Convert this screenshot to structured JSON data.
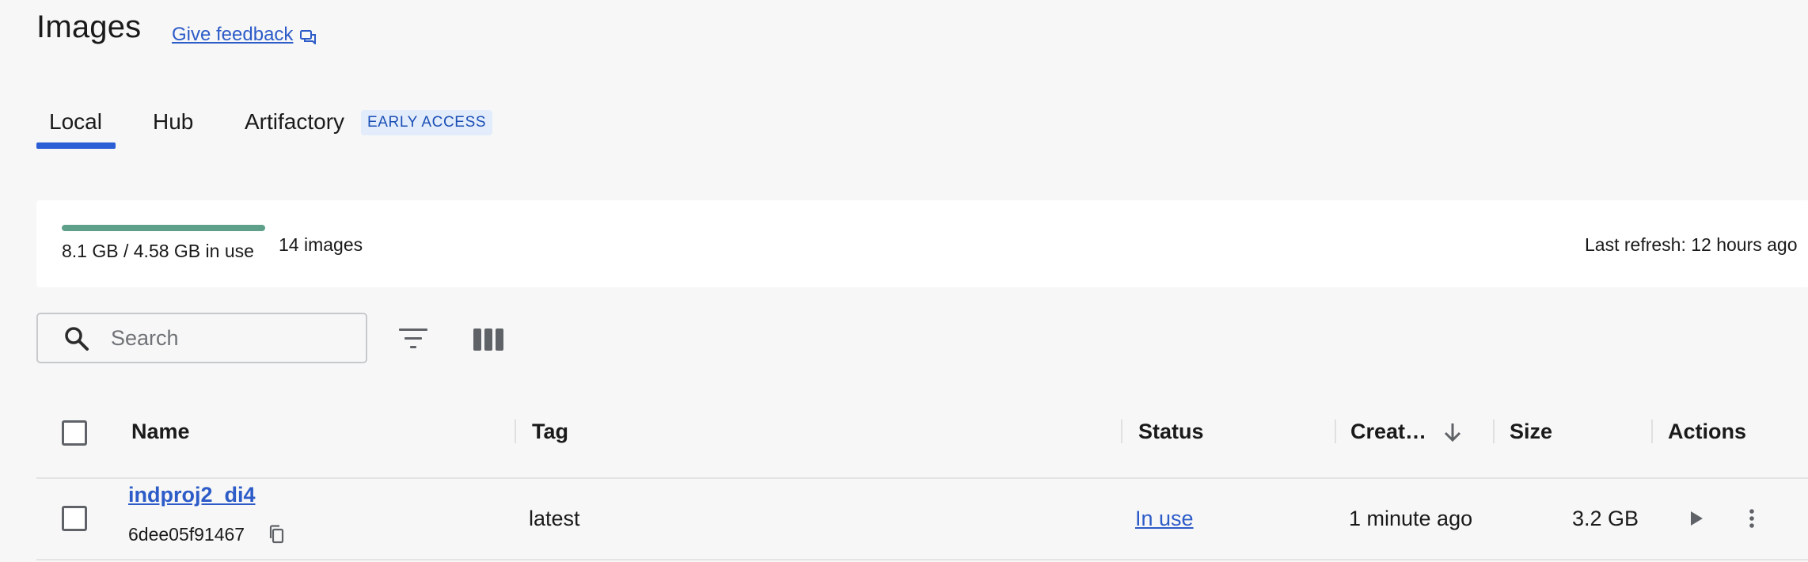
{
  "header": {
    "title": "Images",
    "feedback_label": "Give feedback"
  },
  "tabs": [
    {
      "label": "Local",
      "active": true
    },
    {
      "label": "Hub",
      "active": false
    },
    {
      "label": "Artifactory",
      "active": false,
      "badge": "EARLY ACCESS"
    }
  ],
  "usage": {
    "text": "8.1 GB / 4.58 GB in use",
    "count": "14 images",
    "last_refresh": "Last refresh: 12 hours ago",
    "bar_fill_fraction": 1.0,
    "bar_color": "#5ea08a"
  },
  "toolbar": {
    "search_placeholder": "Search",
    "search_icon": "search-icon",
    "filter_icon": "filter-icon",
    "columns_icon": "columns-icon"
  },
  "table": {
    "columns": [
      "Name",
      "Tag",
      "Status",
      "Creat…",
      "Size",
      "Actions"
    ],
    "sort_column": "Creat…",
    "sort_direction": "descending",
    "rows": [
      {
        "name": "indproj2_di4",
        "id": "6dee05f91467",
        "tag": "latest",
        "status": "In use",
        "created": "1 minute ago",
        "size": "3.2 GB"
      }
    ]
  },
  "colors": {
    "accent": "#2c5fd6",
    "link": "#2d5cc8",
    "badge_bg": "#e3ecfb",
    "background": "#f7f7f7"
  }
}
